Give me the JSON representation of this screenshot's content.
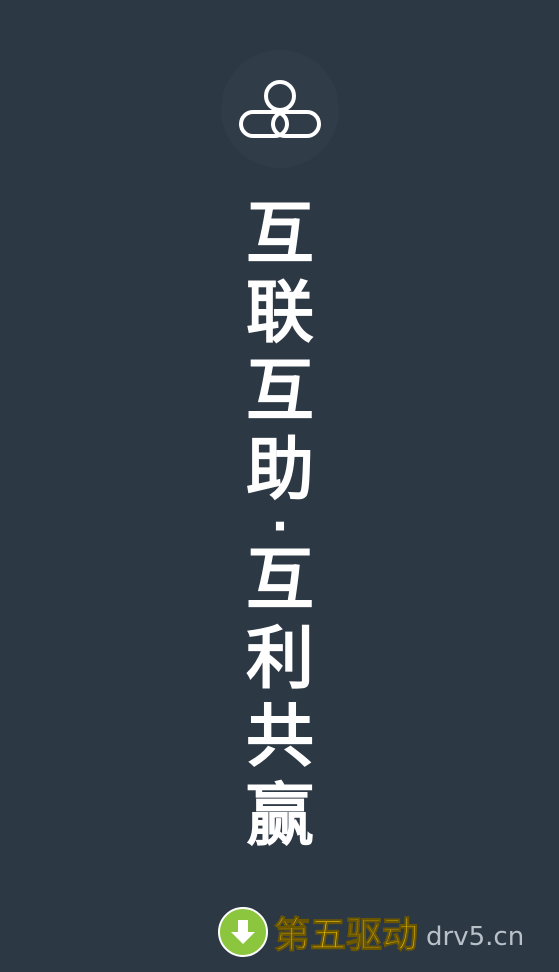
{
  "logo": {
    "icon": "link-cloud-icon"
  },
  "slogan": {
    "chars": [
      "互",
      "联",
      "互",
      "助",
      "·",
      "互",
      "利",
      "共",
      "赢"
    ]
  },
  "watermark": {
    "icon": "download-arrow-icon",
    "brand": "第五驱动",
    "domain": "drv5.cn",
    "colors": {
      "brand": "#f1c40f",
      "icon_bg": "#8cc63f"
    }
  },
  "colors": {
    "background": "#2d3845",
    "text": "#ffffff"
  }
}
